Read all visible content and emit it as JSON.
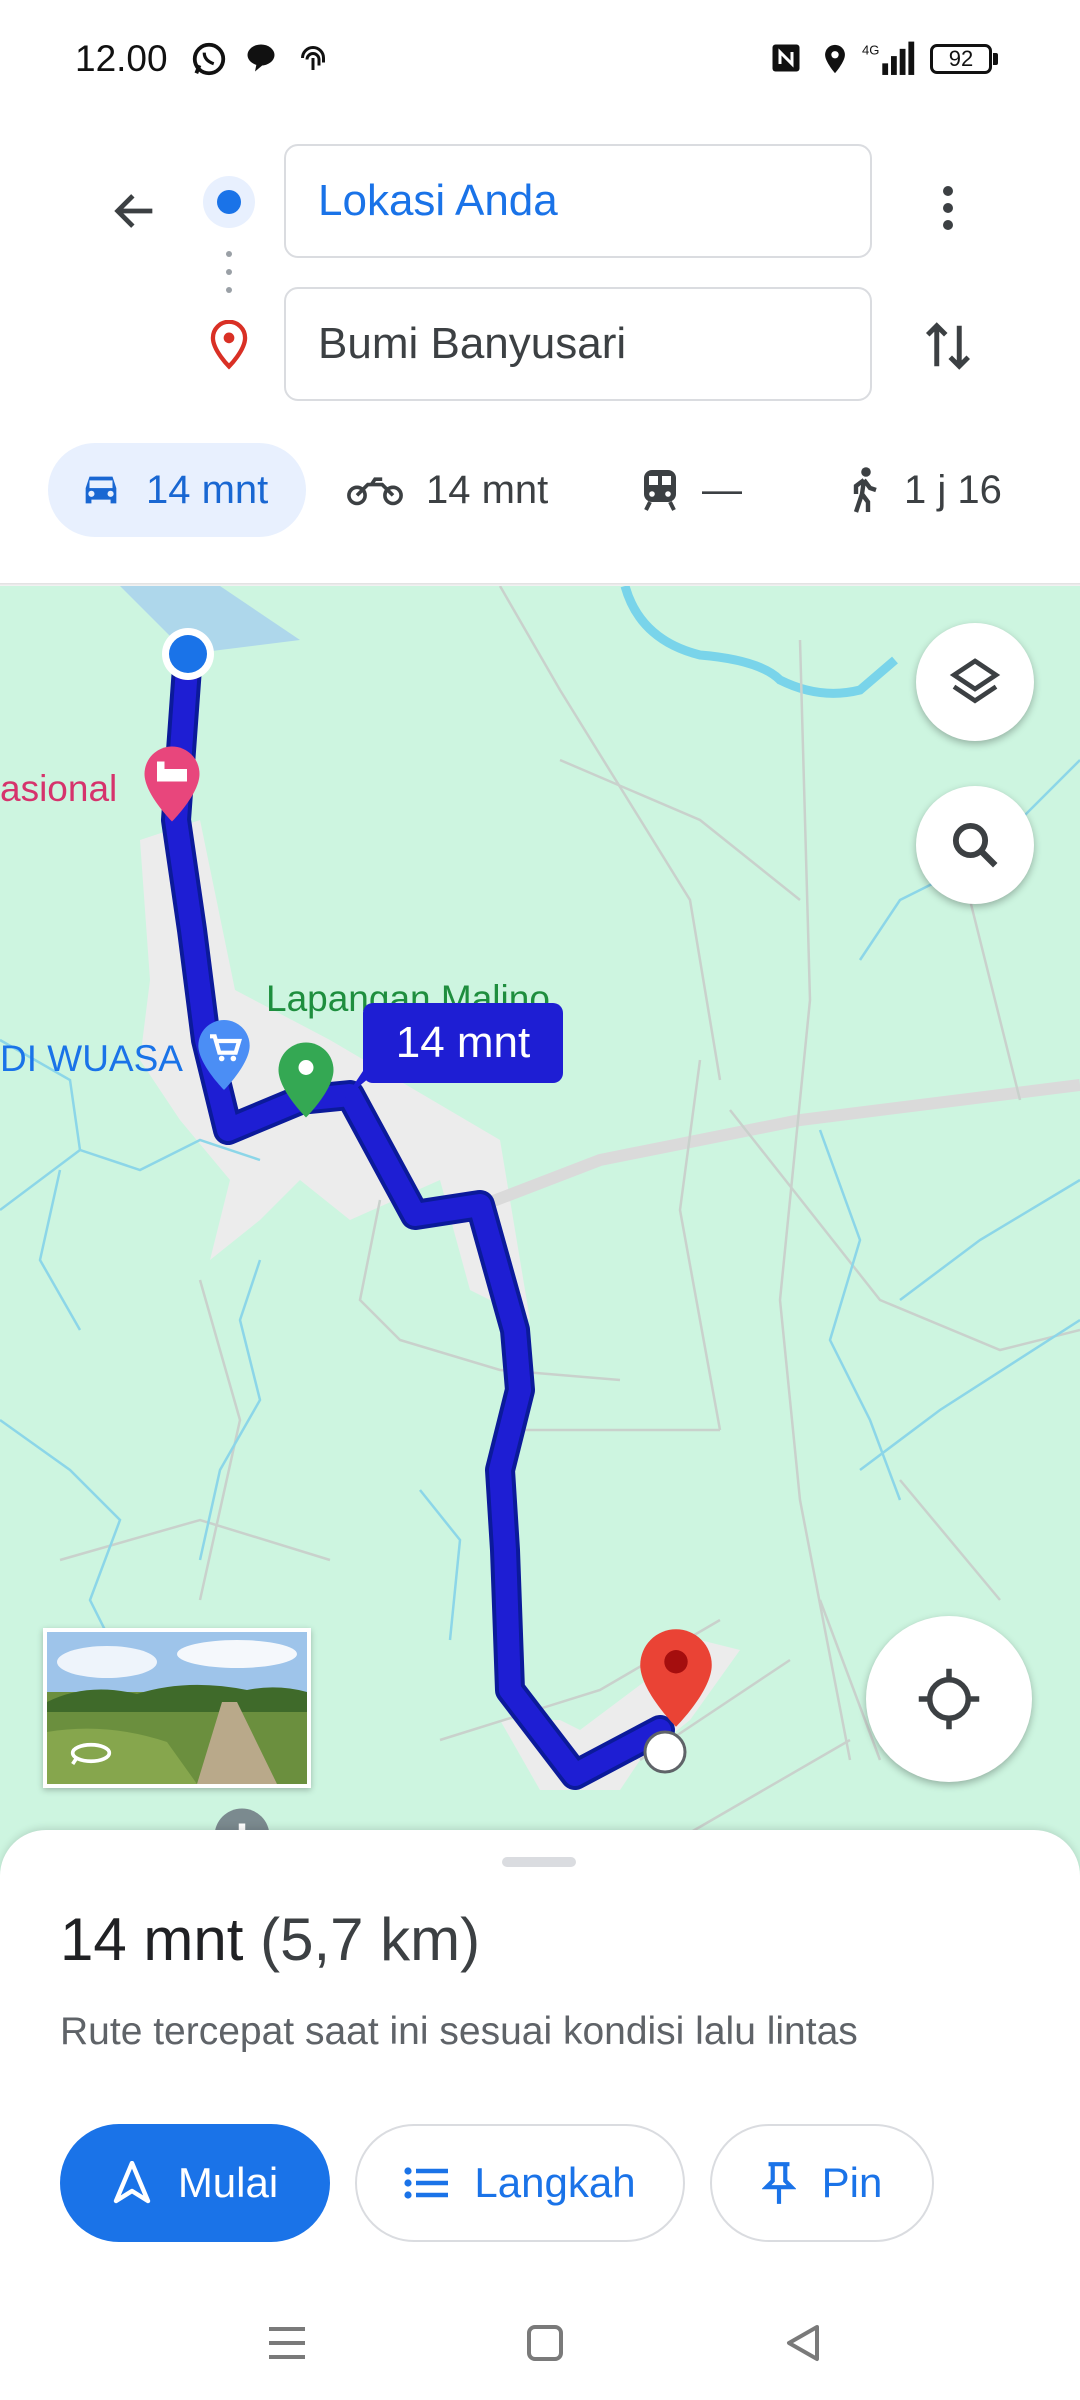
{
  "status_bar": {
    "time": "12.00",
    "network": "4G",
    "battery": "92"
  },
  "directions": {
    "origin": "Lokasi Anda",
    "destination": "Bumi Banyusari"
  },
  "modes": [
    {
      "name": "car",
      "label": "14 mnt",
      "selected": true
    },
    {
      "name": "motorcycle",
      "label": "14 mnt"
    },
    {
      "name": "transit",
      "label": "—"
    },
    {
      "name": "walk",
      "label": "1 j 16"
    }
  ],
  "map": {
    "route_bubble": "14 mnt",
    "poi_hotel_label": "asional",
    "poi_field_label": "Lapangan Malino",
    "poi_shop_label": "DI WUASA",
    "route_color": "#1e1ed3"
  },
  "sheet": {
    "summary_time": "14 mnt",
    "summary_distance": "(5,7 km)",
    "subtitle": "Rute tercepat saat ini sesuai kondisi lalu lintas",
    "start_label": "Mulai",
    "steps_label": "Langkah",
    "pin_label": "Pin"
  },
  "colors": {
    "accent": "#1a73e8",
    "map_bg": "#cdf5e0",
    "mode_selected_bg": "#e8f0fe"
  }
}
